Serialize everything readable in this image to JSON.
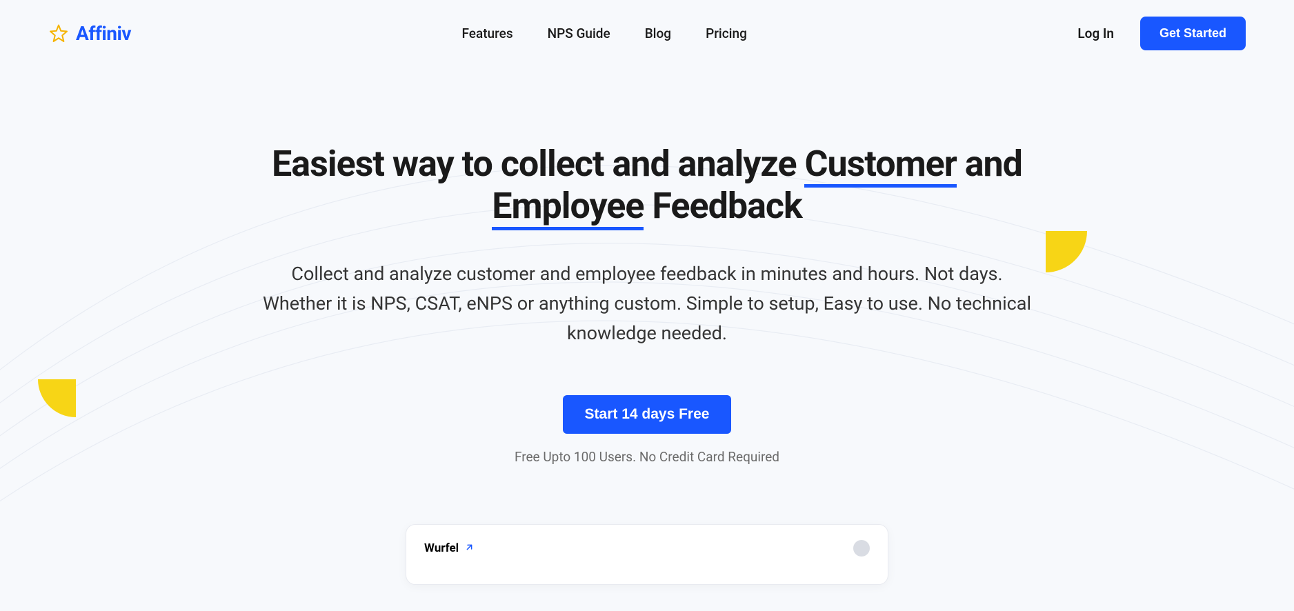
{
  "brand": {
    "name": "Affiniv"
  },
  "nav": {
    "features": "Features",
    "npsGuide": "NPS Guide",
    "blog": "Blog",
    "pricing": "Pricing",
    "login": "Log In",
    "getStarted": "Get Started"
  },
  "hero": {
    "title_pre": "Easiest way to collect and analyze ",
    "title_u1": "Customer",
    "title_mid": " and ",
    "title_u2": "Employee",
    "title_post": " Feedback",
    "subtitle": "Collect and analyze customer and employee feedback in minutes and hours. Not days. Whether it is NPS, CSAT, eNPS or anything custom. Simple to setup, Easy to use. No technical knowledge needed.",
    "cta": "Start 14 days Free",
    "note": "Free Upto 100 Users. No Credit Card Required"
  },
  "preview": {
    "brand": "Wurfel"
  }
}
